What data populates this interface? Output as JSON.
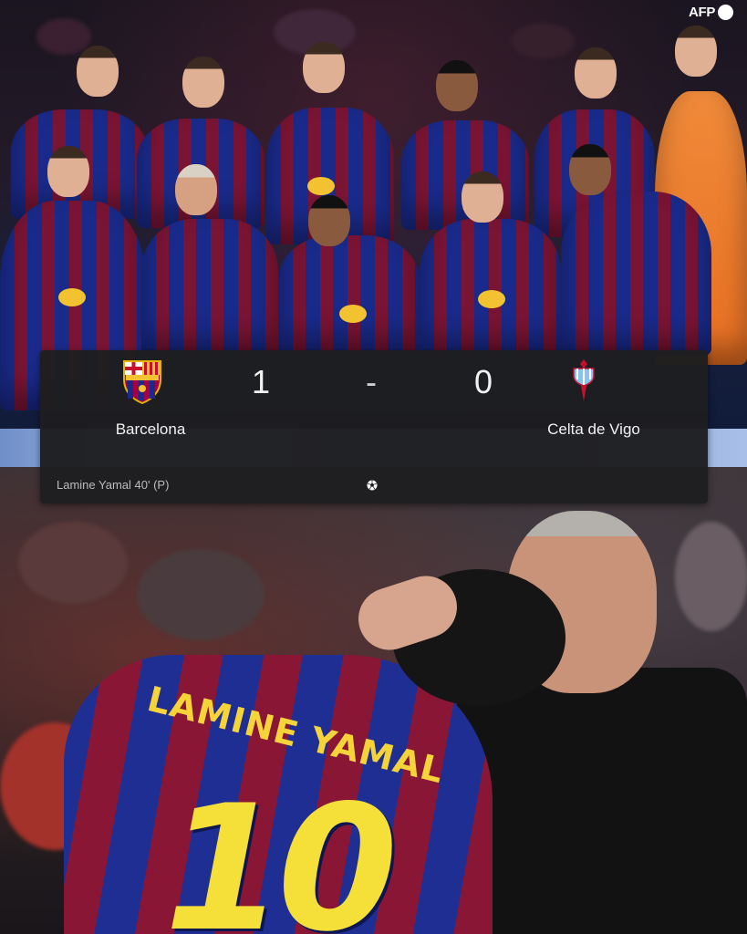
{
  "watermark": {
    "label": "AFP"
  },
  "team_photo": {
    "kit_colors": {
      "blue": "#1a2a8a",
      "garnet": "#7a1434",
      "keeper": "#e86f22",
      "sponsor": "#f2c230"
    }
  },
  "scoreboard": {
    "home": {
      "team": "Barcelona",
      "score": "1",
      "crest": "fc-barcelona-crest"
    },
    "away": {
      "team": "Celta de Vigo",
      "score": "0",
      "crest": "celta-de-vigo-crest"
    },
    "separator": "-",
    "goals": [
      "Lamine Yamal 40' (P)"
    ],
    "goal_icon": "soccer-ball-icon"
  },
  "celebration_photo": {
    "jersey_name": "LAMINE YAMAL",
    "jersey_number": "10"
  }
}
